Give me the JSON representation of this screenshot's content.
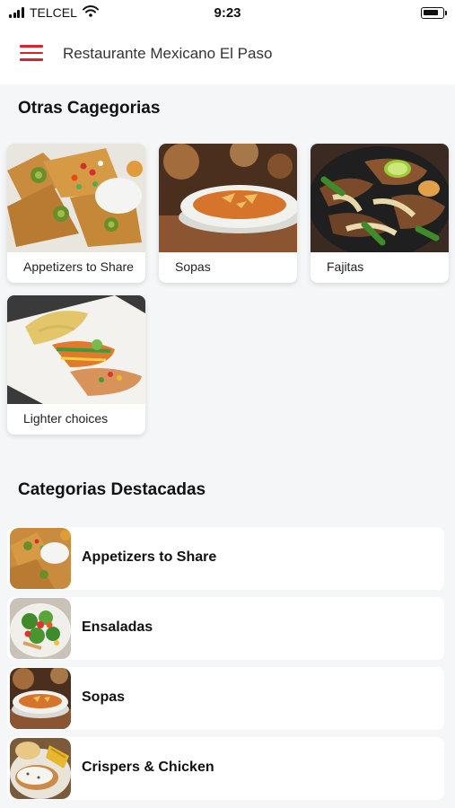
{
  "status_bar": {
    "carrier": "TELCEL",
    "time": "9:23"
  },
  "header": {
    "title": "Restaurante Mexicano El Paso"
  },
  "otras": {
    "title": "Otras Cagegorias",
    "cards": [
      {
        "label": "Appetizers to Share",
        "image": "nachos-photo"
      },
      {
        "label": "Sopas",
        "image": "soup-photo"
      },
      {
        "label": "Fajitas",
        "image": "fajitas-photo"
      },
      {
        "label": "Lighter choices",
        "image": "lighter-plate-photo"
      }
    ]
  },
  "destacadas": {
    "title": "Categorias Destacadas",
    "items": [
      {
        "label": "Appetizers to Share",
        "image": "nachos-photo"
      },
      {
        "label": "Ensaladas",
        "image": "salad-photo"
      },
      {
        "label": "Sopas",
        "image": "soup-photo"
      },
      {
        "label": "Crispers & Chicken",
        "image": "chicken-photo"
      }
    ]
  }
}
